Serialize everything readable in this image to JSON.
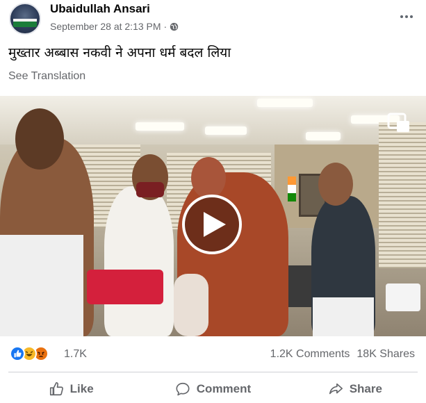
{
  "post": {
    "author": "Ubaidullah Ansari",
    "timestamp": "September 28 at 2:13 PM",
    "separator": "·",
    "privacy_icon": "globe-icon",
    "text": "मुख्तार अब्बास नकवी ने अपना धर्म बदल लिया",
    "see_translation": "See Translation"
  },
  "video": {
    "play_icon": "play-icon",
    "mini_player_icon": "mini-player-icon"
  },
  "engagement": {
    "reaction_icons": [
      "like-reaction-icon",
      "haha-reaction-icon",
      "angry-reaction-icon"
    ],
    "reaction_count": "1.7K",
    "comments": "1.2K Comments",
    "shares": "18K Shares"
  },
  "actions": {
    "like": "Like",
    "comment": "Comment",
    "share": "Share"
  },
  "colors": {
    "like_blue": "#1877f2",
    "haha_yellow": "#f7b928",
    "angry_orange": "#e9710f",
    "secondary_text": "#65676b"
  }
}
